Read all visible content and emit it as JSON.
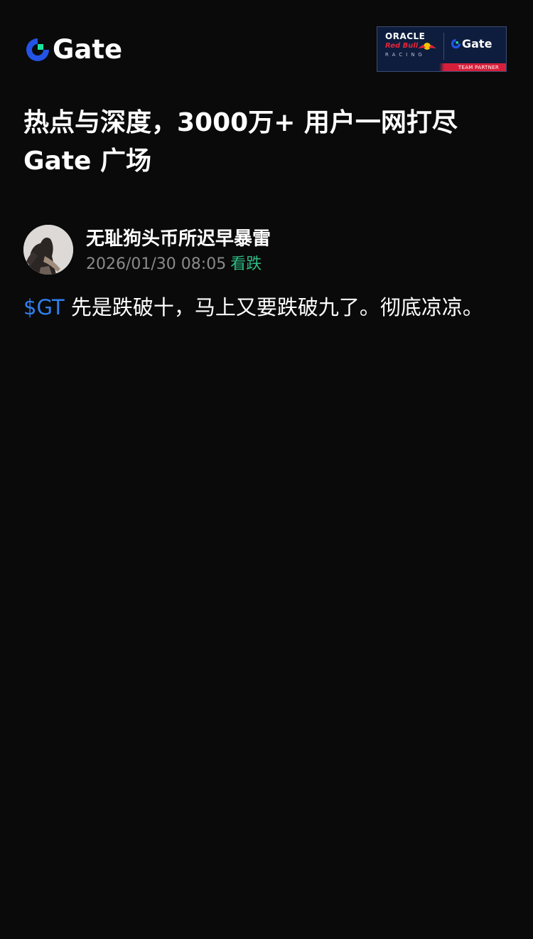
{
  "header": {
    "logo_text": "Gate",
    "partner_badge": {
      "oracle": "ORACLE",
      "redbull": "Red Bull",
      "racing": "RACING",
      "gate": "Gate",
      "caption": "TEAM PARTNER"
    }
  },
  "headline": {
    "line1": "热点与深度，3000万+ 用户一网打尽",
    "line2": "Gate 广场"
  },
  "post": {
    "author": "无耻狗头币所迟早暴雷",
    "timestamp": "2026/01/30 08:05",
    "sentiment": "看跌",
    "ticker": "$GT",
    "text": " 先是跌破十，马上又要跌破九了。彻底凉凉。"
  },
  "colors": {
    "background": "#0a0a0a",
    "brand_blue": "#2354e6",
    "brand_green": "#17e6a1",
    "bearish_green": "#2ebd85",
    "ticker_blue": "#2f80ed",
    "meta_gray": "#8a8a8a"
  },
  "icons": {
    "logo": "gate-logo-icon",
    "bull": "red-bull-icon"
  }
}
